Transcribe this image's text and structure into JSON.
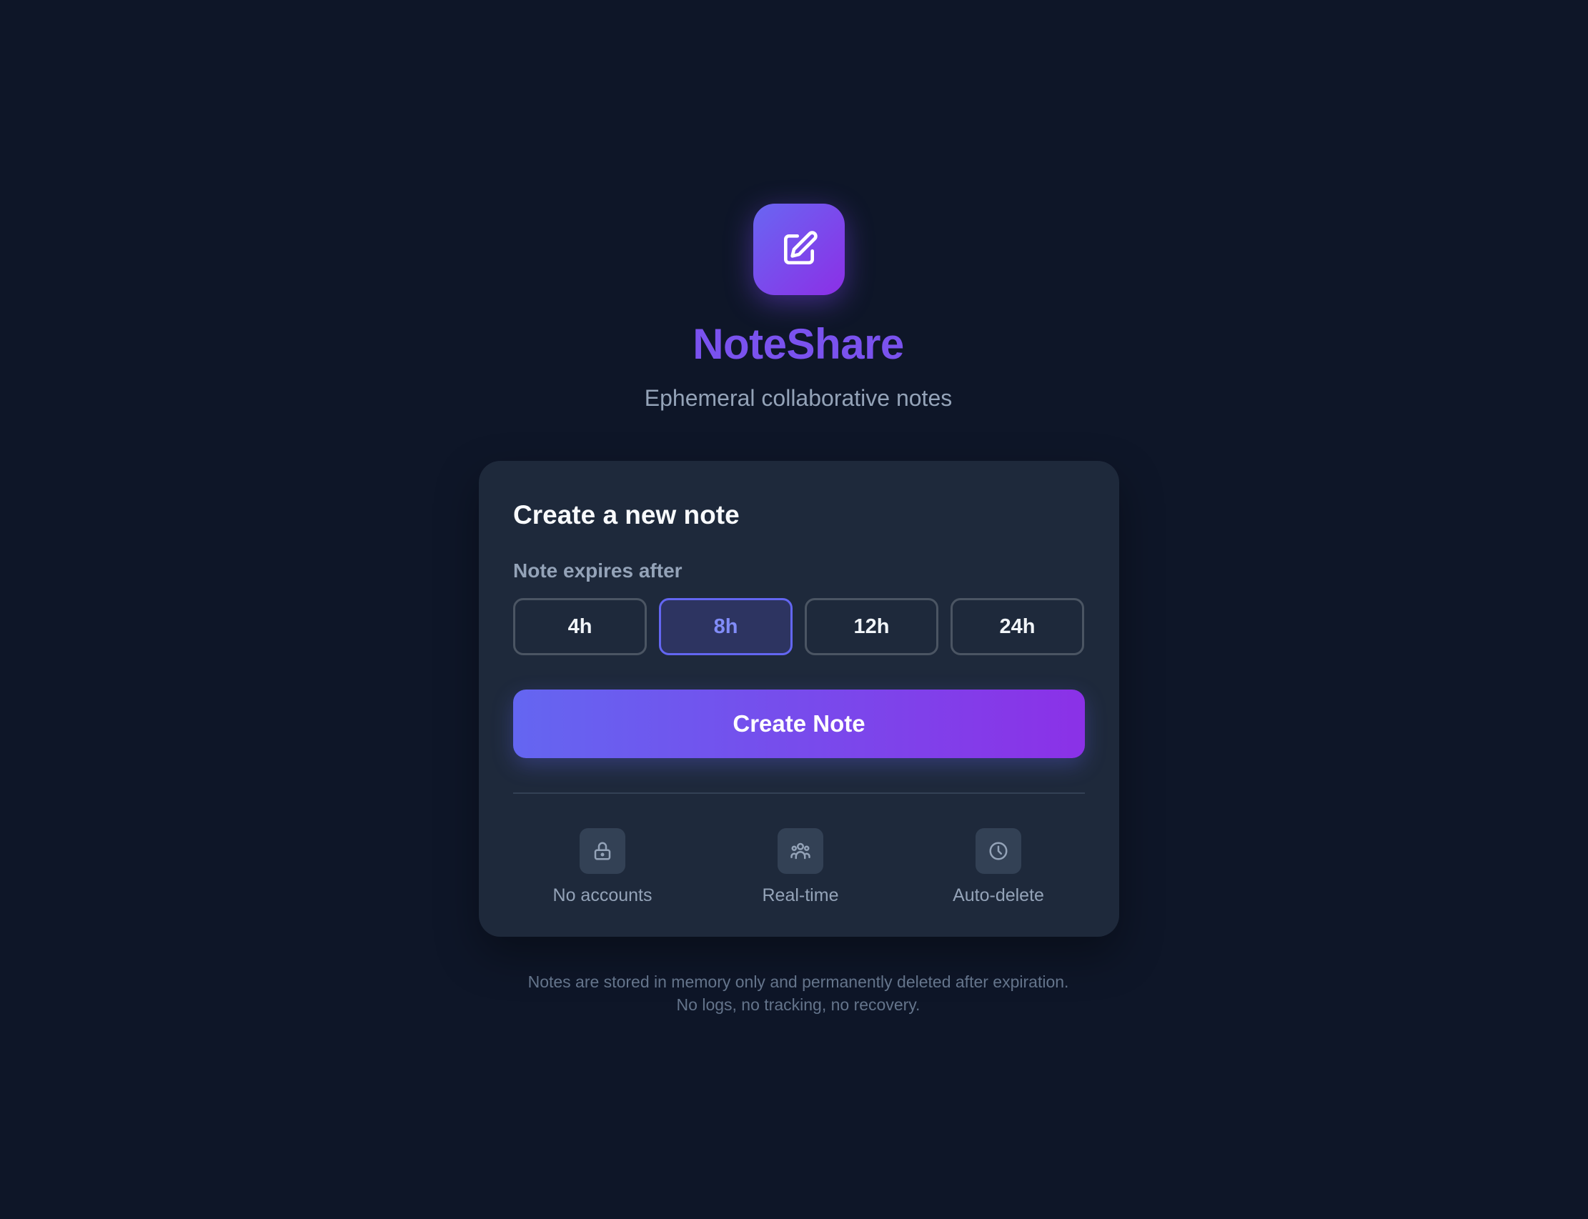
{
  "brand": {
    "title": "NoteShare",
    "subtitle": "Ephemeral collaborative notes",
    "icon": "edit-note-icon"
  },
  "card": {
    "title": "Create a new note",
    "expiry_label": "Note expires after",
    "expiry_options": [
      "4h",
      "8h",
      "12h",
      "24h"
    ],
    "expiry_selected": "8h",
    "create_label": "Create Note",
    "features": [
      {
        "label": "No accounts",
        "icon": "lock-icon"
      },
      {
        "label": "Real-time",
        "icon": "users-icon"
      },
      {
        "label": "Auto-delete",
        "icon": "clock-icon"
      }
    ]
  },
  "footer": {
    "line1": "Notes are stored in memory only and permanently deleted after expiration.",
    "line2": "No logs, no tracking, no recovery."
  },
  "colors": {
    "background": "#0e1628",
    "card": "#1e293b",
    "accent_start": "#6366f1",
    "accent_end": "#8b31e7",
    "brand_text": "#7a52ee"
  }
}
